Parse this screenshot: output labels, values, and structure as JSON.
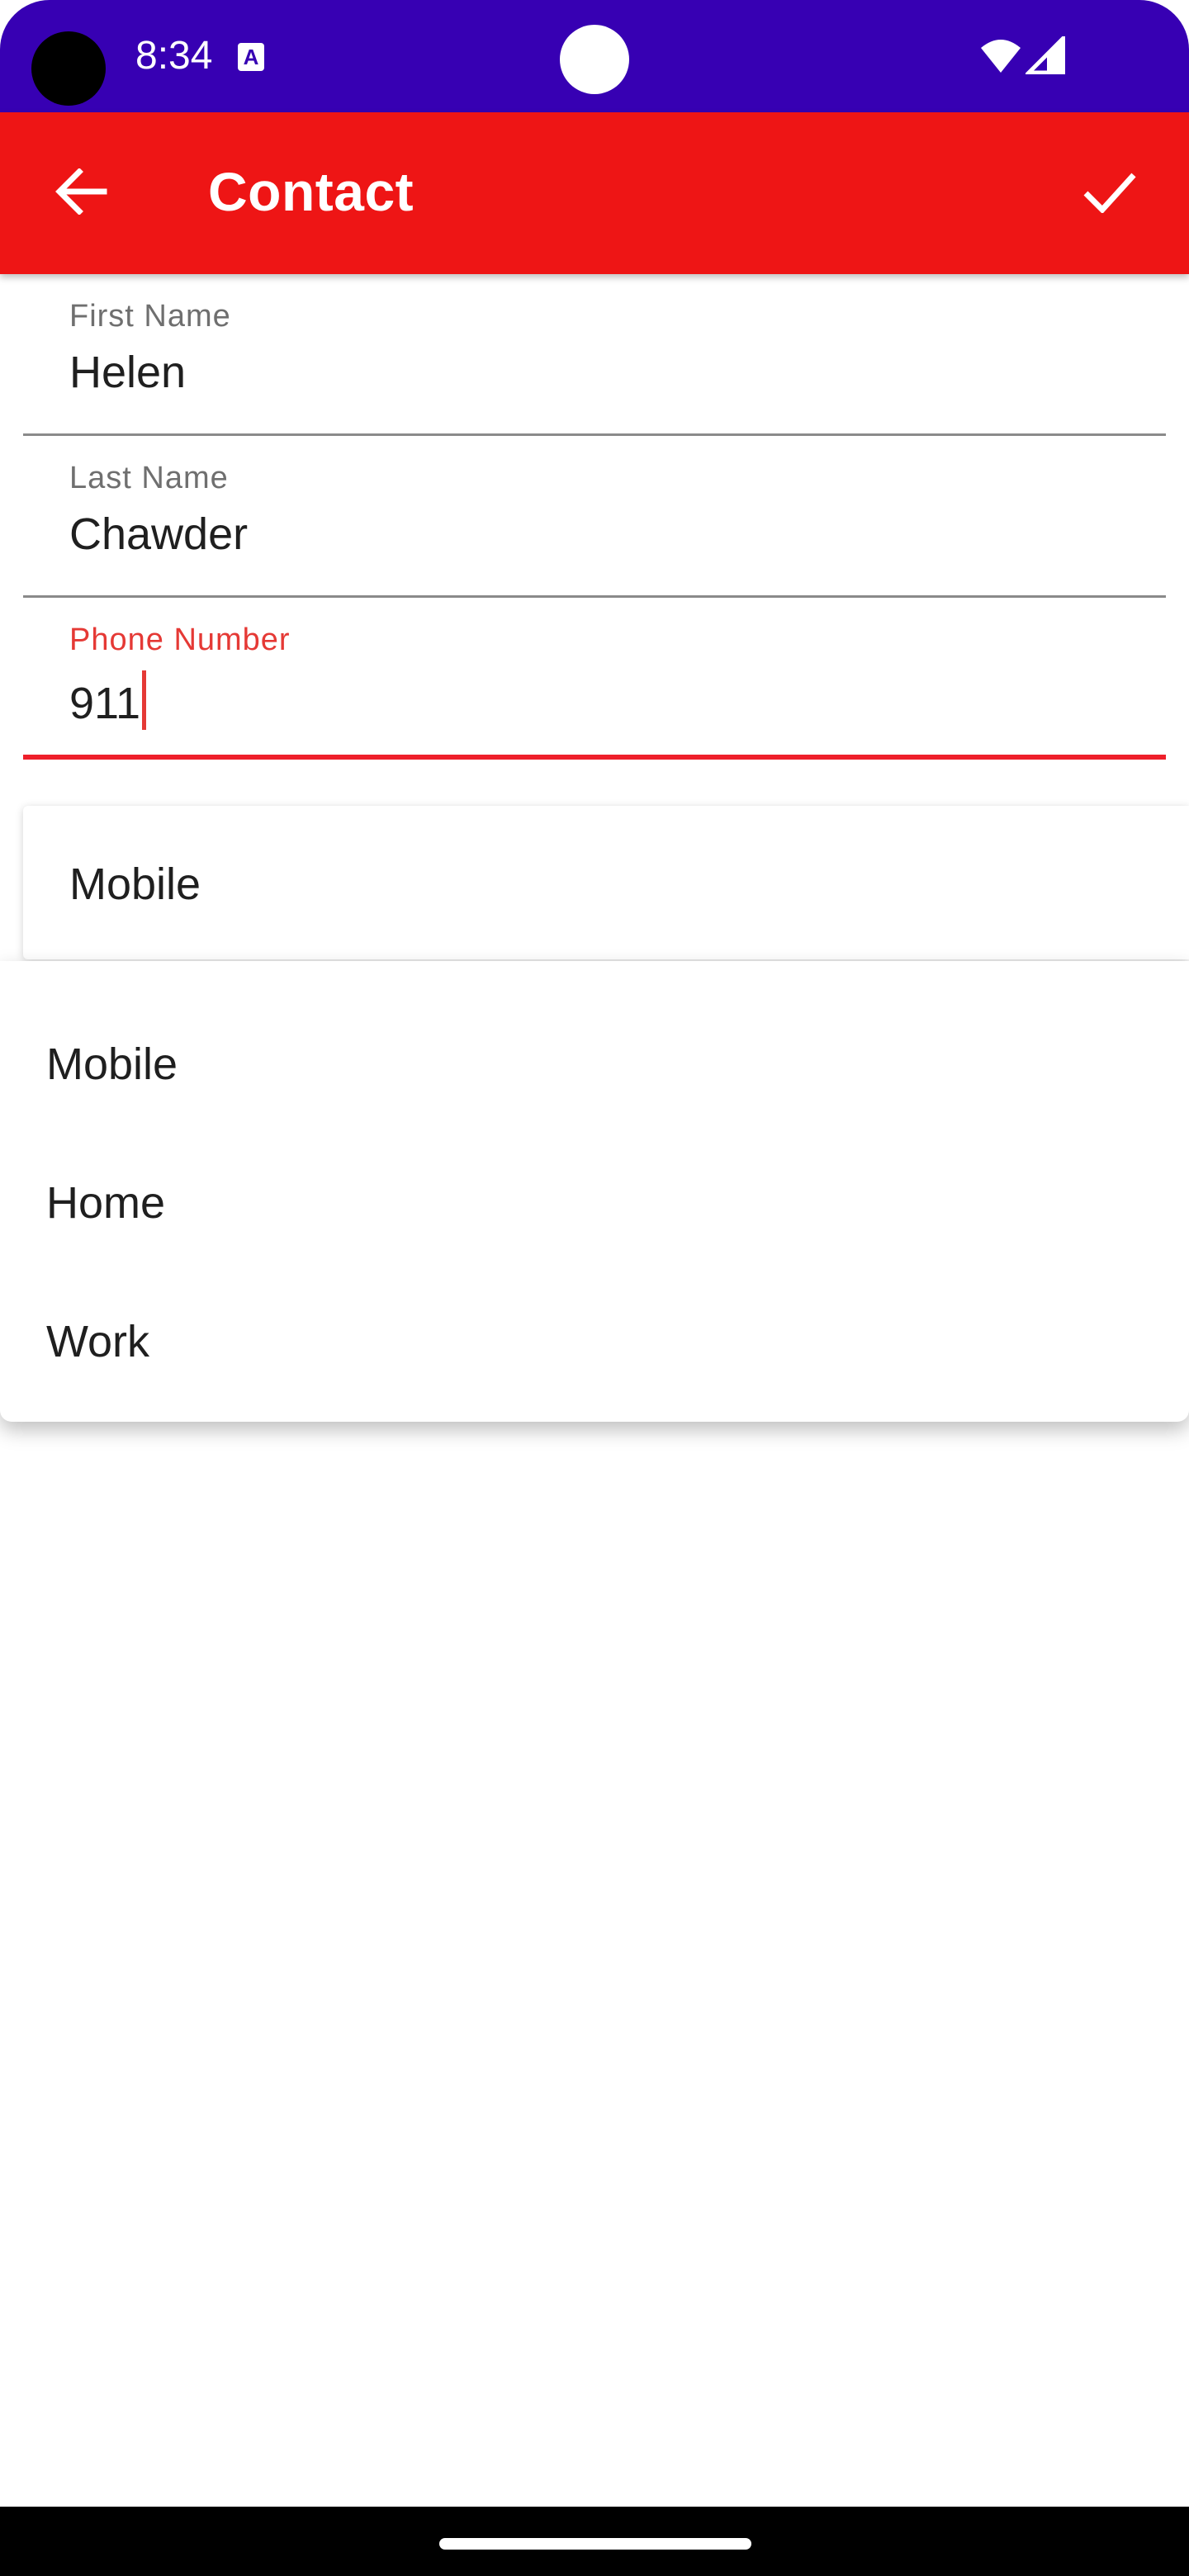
{
  "status_bar": {
    "time": "8:34",
    "notification_icon": "A"
  },
  "app_bar": {
    "title": "Contact",
    "back_icon": "arrow-left-icon",
    "save_icon": "check-icon"
  },
  "form": {
    "first_name": {
      "label": "First Name",
      "value": "Helen"
    },
    "last_name": {
      "label": "Last Name",
      "value": "Chawder"
    },
    "phone": {
      "label": "Phone Number",
      "value": "911"
    },
    "phone_type": {
      "selected": "Mobile"
    }
  },
  "dropdown": {
    "options": [
      "Mobile",
      "Home",
      "Work"
    ]
  },
  "colors": {
    "status_bar": "#3700b3",
    "app_bar": "#ee1515",
    "accent": "#e53935"
  }
}
